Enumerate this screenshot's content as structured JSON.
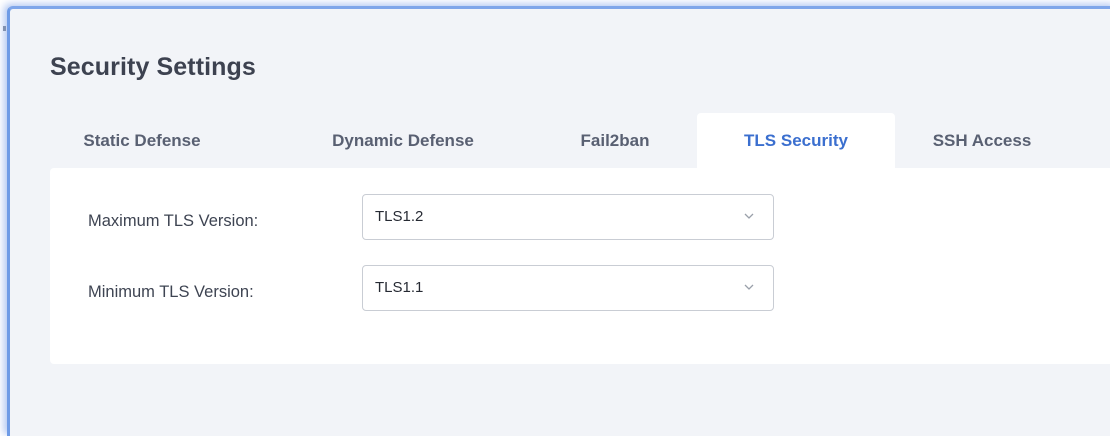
{
  "page": {
    "title": "Security Settings"
  },
  "tabs": [
    {
      "label": "Static Defense",
      "active": false
    },
    {
      "label": "Dynamic Defense",
      "active": false
    },
    {
      "label": "Fail2ban",
      "active": false
    },
    {
      "label": "TLS Security",
      "active": true
    },
    {
      "label": "SSH Access",
      "active": false
    }
  ],
  "form": {
    "max_tls": {
      "label": "Maximum TLS Version:",
      "value": "TLS1.2"
    },
    "min_tls": {
      "label": "Minimum TLS Version:",
      "value": "TLS1.1"
    }
  },
  "icons": {
    "dropdown": "chevron-down-icon"
  },
  "colors": {
    "accent": "#3b6fcf",
    "window_border": "#6e9be6",
    "background": "#f2f4f8",
    "panel": "#ffffff"
  }
}
